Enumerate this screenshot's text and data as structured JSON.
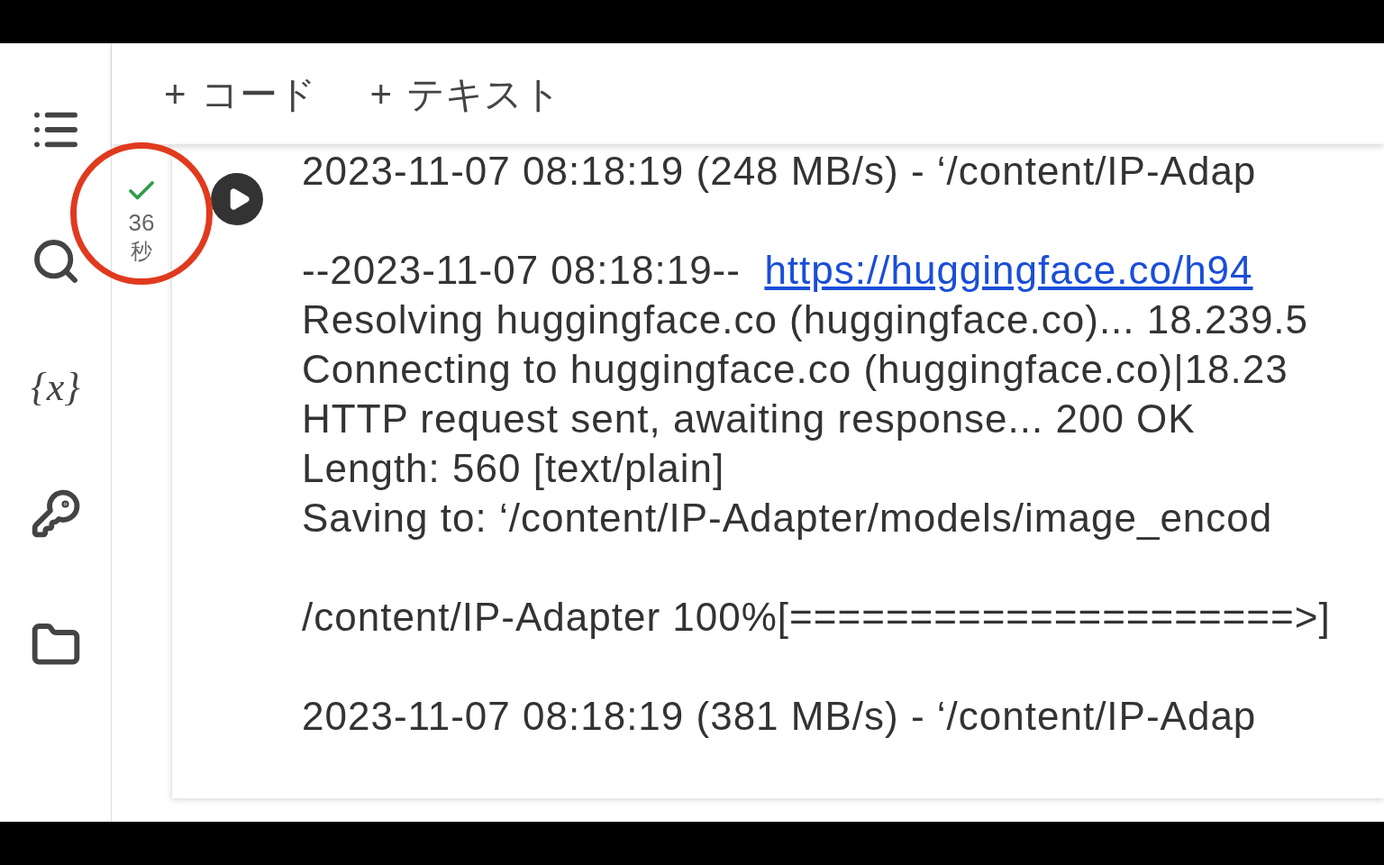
{
  "sidebar": {
    "items": [
      {
        "kind": "menu"
      },
      {
        "kind": "search"
      },
      {
        "kind": "variables",
        "glyph": "{x}"
      },
      {
        "kind": "key"
      },
      {
        "kind": "folder"
      }
    ]
  },
  "toolbar": {
    "buttons": [
      {
        "icon": "+",
        "label": "コード"
      },
      {
        "icon": "+",
        "label": "テキスト"
      }
    ]
  },
  "cell": {
    "status": {
      "done": true,
      "time": "36",
      "unit": "秒",
      "highlighted": true
    },
    "output": [
      {
        "lines": [
          {
            "text": "2023-11-07 08:18:19 (248 MB/s) - ‘/content/IP-Adap"
          }
        ]
      },
      {
        "lines": [
          {
            "text": "--2023-11-07 08:18:19--  ",
            "link": "https://huggingface.co/h94"
          },
          {
            "text": "Resolving huggingface.co (huggingface.co)... 18.239.5"
          },
          {
            "text": "Connecting to huggingface.co (huggingface.co)|18.23"
          },
          {
            "text": "HTTP request sent, awaiting response... 200 OK"
          },
          {
            "text": "Length: 560 [text/plain]"
          },
          {
            "text": "Saving to: ‘/content/IP-Adapter/models/image_encod"
          }
        ]
      },
      {
        "lines": [
          {
            "text": "/content/IP-Adapter 100%[=====================>]"
          }
        ]
      },
      {
        "lines": [
          {
            "text": "2023-11-07 08:18:19 (381 MB/s) - ‘/content/IP-Adap"
          }
        ]
      }
    ]
  }
}
